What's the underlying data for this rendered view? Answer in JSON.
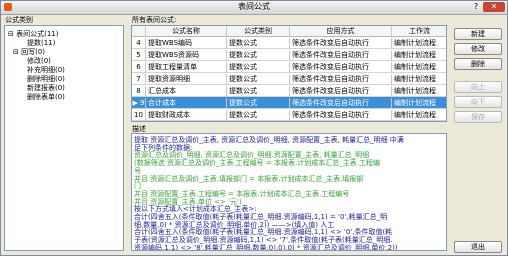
{
  "window": {
    "title": "表间公式",
    "help": "?",
    "close": "✕"
  },
  "left_panel": {
    "label": "公式类别",
    "tree": [
      {
        "text": "⊟ 表间公式(11)"
      },
      {
        "text": "提数(11)"
      },
      {
        "text": "⊟ 回写(0)"
      },
      {
        "text": "修改(0)"
      },
      {
        "text": "补充明细(0)"
      },
      {
        "text": "删除明细(0)"
      },
      {
        "text": "新建报表(0)"
      },
      {
        "text": "删除表单(0)"
      }
    ]
  },
  "grid": {
    "label": "所有表间公式:",
    "columns": [
      "",
      "公式名称",
      "公式类别",
      "应用方式",
      "工作流"
    ],
    "rows": [
      [
        "4",
        "提取WBS编码",
        "提数公式",
        "筛选条件改变后自动执行",
        "编制计划流程"
      ],
      [
        "5",
        "提取WBS资源码",
        "提数公式",
        "筛选条件改变后自动执行",
        "编制计划流程"
      ],
      [
        "6",
        "提取工程量清单",
        "提数公式",
        "筛选条件改变后自动执行",
        "编制计划流程"
      ],
      [
        "7",
        "提取资源明细",
        "提数公式",
        "筛选条件改变后自动执行",
        "编制计划流程"
      ],
      [
        "8",
        "汇总成本",
        "提数公式",
        "筛选条件改变后自动执行",
        "编制计划流程"
      ],
      [
        "▶ 9",
        "合计成本",
        "提数公式",
        "筛选条件改变后自动执行",
        "编制计划流程"
      ],
      [
        "10",
        "提取财政成本",
        "提数公式",
        "筛选条件改变后自动执行",
        "编制计划流程"
      ]
    ],
    "selected_row": 5
  },
  "buttons": {
    "new": "新建",
    "edit": "修改",
    "delete": "删除",
    "up": "向上",
    "down": "向下",
    "save": "保存",
    "exit": "退出"
  },
  "description": {
    "label": "描述",
    "lines": [
      {
        "text": "提取 资源汇总及调价_主表, 资源汇总及调价_明细, 资源配置_主表, 耗量汇总_明细 中满",
        "color": "#1a1a9c"
      },
      {
        "text": "足下列条件的数据:",
        "color": "#1a1a9c"
      },
      {
        "text": "       资源汇总及调价_明细, 资源汇总及调价_明细.资源配置_主表, 耗量汇总_明细",
        "color": "#38a038"
      },
      {
        "text": "       (数据筛选  资源汇总及调价_主表.工程编号 = 本报表.计划成本汇总_主表.工程编",
        "color": "#38a038"
      },
      {
        "text": "号",
        "color": "#38a038"
      },
      {
        "text": "           并且 资源汇总及调价_主表.填报部门 = 本报表.计划成本汇总_主表.填报部",
        "color": "#38a038"
      },
      {
        "text": "门",
        "color": "#38a038"
      },
      {
        "text": "           并且 资源配置_主表.工程编号 = 本报表.计划成本汇总_主表.工程编号",
        "color": "#38a038"
      },
      {
        "text": "           并且 资源配置_主表.单位 <> '元')",
        "color": "#38a038"
      },
      {
        "text": "按以下方式填入<计划成本汇总_主表>:",
        "color": "#1a1a9c"
      },
      {
        "text": "合计(四舍五入(条件取值(耗子表(耗量汇总_明细.资源编码,1,1) = '0',耗量汇总_明",
        "color": "#1a1a9c"
      },
      {
        "text": "细.数量,0) * 资源汇总及调价_明细.单价,2)) ——>(填入值) 人工",
        "color": "#1a1a9c"
      },
      {
        "text": "合计(四舍五入(条件取值(耗子表(耗量汇总_明细.资源编码,1,1) <> '0',条件取值(耗",
        "color": "#1a1a9c"
      },
      {
        "text": "子表(资源汇总及调价_明细.资源编码,1,1) <> '7',条件取值(耗子表(耗量汇总_明细.",
        "color": "#1a1a9c"
      },
      {
        "text": "资源编码,1,1) <> '8',耗量汇总_明细.数量,0),0),0) * 资源汇总及调价_明细.单价,2))",
        "color": "#1a1a9c"
      }
    ]
  }
}
